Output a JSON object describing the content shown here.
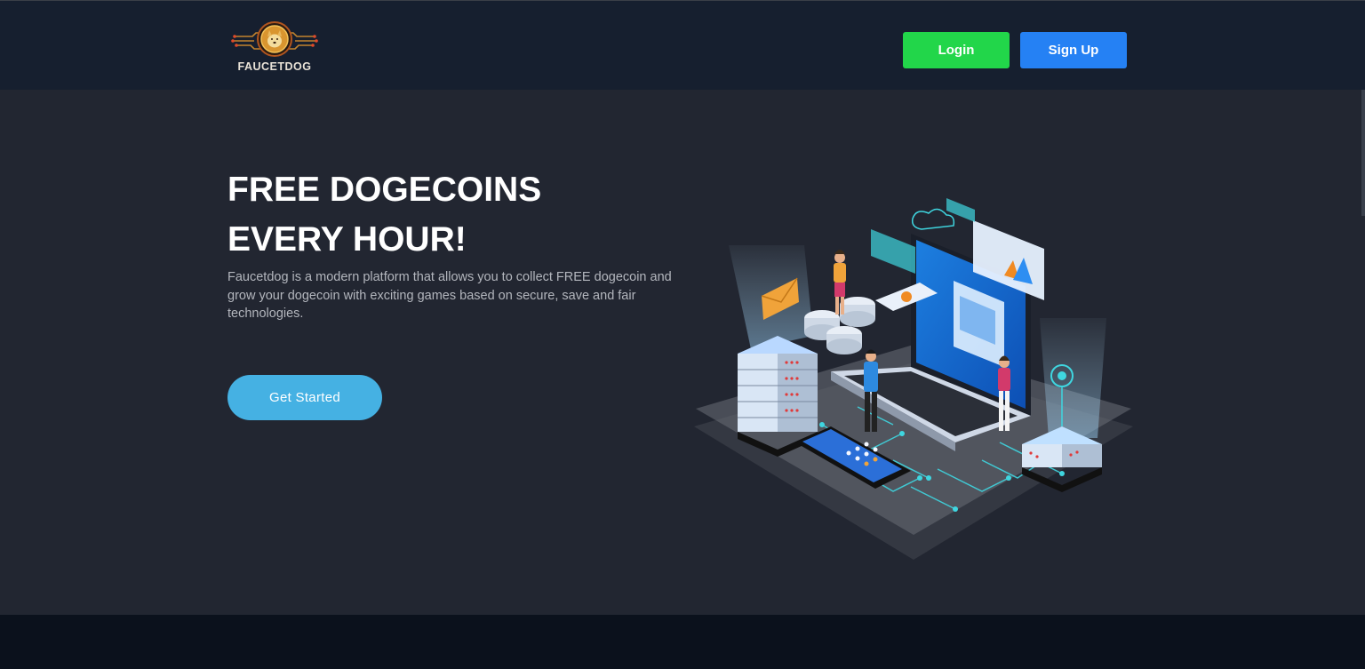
{
  "header": {
    "logo_text": "FAUCETDOG",
    "login_label": "Login",
    "signup_label": "Sign Up"
  },
  "hero": {
    "headline_line1": "FREE DOGECOINS",
    "headline_line2": "EVERY HOUR!",
    "description": "Faucetdog is a modern platform that allows you to collect FREE dogecoin and grow your dogecoin with exciting games based on secure, save and fair technologies.",
    "cta_label": "Get Started"
  },
  "colors": {
    "header_bg": "#161f2f",
    "hero_bg": "#222631",
    "footer_bg": "#0b111c",
    "login_green": "#22d64a",
    "signup_blue": "#2581f4",
    "cta_blue": "#45b1e3"
  },
  "icons": [
    "logo-emblem",
    "isometric-tech-illustration"
  ]
}
